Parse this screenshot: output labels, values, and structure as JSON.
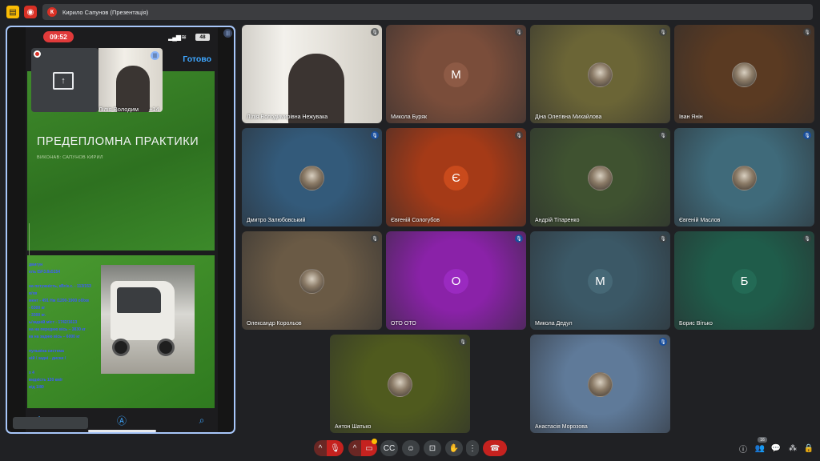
{
  "topbar": {
    "presenter_initial": "К",
    "presentation_label": "Кирило Сапунов (Презентація)"
  },
  "phone": {
    "time": "09:52",
    "battery": "48",
    "done_label": "Готово",
    "slide_title": "ПРЕДЕПЛОМНА ПРАКТИКИ",
    "slide_subtitle": "ВИКОНАВ: САПУНОВ КИРИЛ",
    "slide2_lines": [
      "двигун",
      "ель ISF3.8s5154",
      "",
      "на потужність, кВт/к.с. - 113/153",
      "в/хв",
      "мент - 491 Нм /1200-1900 об/хв",
      "- 6300 кг",
      "- 3300 кг.",
      "ь/задній міст - 1742/1613",
      "на на передню вісь – 3830 кг",
      "ка на задню вісь – 6000 кг",
      "",
      "пульвіна система",
      "ній / задні - диски /",
      "",
      "x 4",
      "видкість 120 км/г",
      "від 1/80"
    ]
  },
  "self_view": {
    "name": "Лілія Володим",
    "more_count": "+14"
  },
  "participants": [
    {
      "name": "Лілія Володимирівна Нежувака",
      "kind": "video"
    },
    {
      "name": "Микола Буряк",
      "initial": "M",
      "kind": "initial",
      "color": "#7a4d3a",
      "avatar": "#8d5a45"
    },
    {
      "name": "Діна Олегівна Михайлова",
      "kind": "photo",
      "color": "#6b6536"
    },
    {
      "name": "Іван Янін",
      "kind": "photo",
      "color": "#5a3a22"
    },
    {
      "name": "Дмитро Залюбовський",
      "kind": "photo",
      "color": "#335a7a"
    },
    {
      "name": "Євгеній Сологубов",
      "initial": "Є",
      "kind": "initial",
      "color": "#a53a17",
      "avatar": "#c94a1c"
    },
    {
      "name": "Андрій Тітаренко",
      "kind": "photo",
      "color": "#3f5230"
    },
    {
      "name": "Євгеній Маслов",
      "kind": "photo",
      "color": "#3f6a7a"
    },
    {
      "name": "Олександр Корольов",
      "kind": "photo",
      "color": "#6a5a45"
    },
    {
      "name": "ОТО ОТО",
      "initial": "O",
      "kind": "initial",
      "color": "#8a22a8",
      "avatar": "#9a2ac0"
    },
    {
      "name": "Микола Дедул",
      "initial": "M",
      "kind": "initial",
      "color": "#3b5866",
      "avatar": "#466876"
    },
    {
      "name": "Борис Вітько",
      "initial": "Б",
      "kind": "initial",
      "color": "#1f5c4a",
      "avatar": "#236a55"
    },
    {
      "name": "Антон Шатько",
      "kind": "photo",
      "color": "#4f5a1e"
    },
    {
      "name": "Анастасія Морозова",
      "kind": "photo",
      "color": "#5f7a99"
    }
  ],
  "controls": {
    "participants_count": "16"
  },
  "icons": {
    "hand": "raise-hand-icon",
    "mic": "mic-off-icon",
    "camera": "camera-off-icon",
    "end": "end-call-icon"
  }
}
